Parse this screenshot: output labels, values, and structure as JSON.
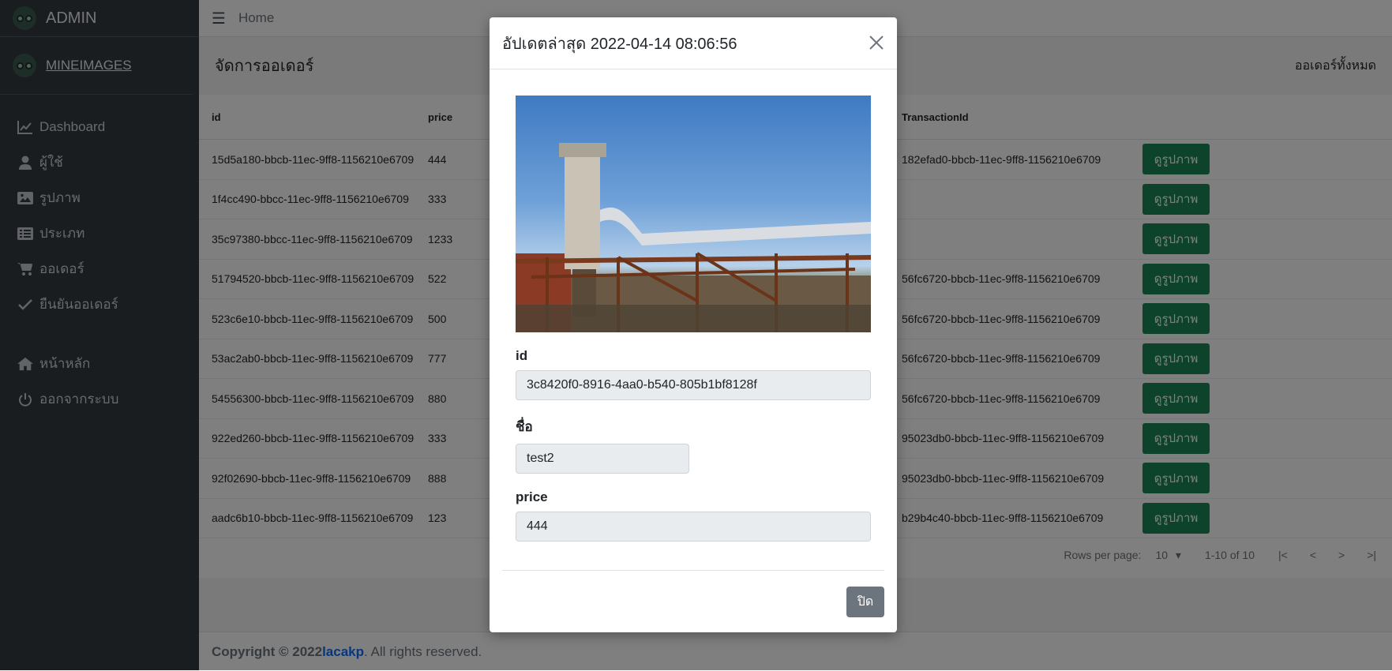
{
  "sidebar": {
    "brand": "ADMIN",
    "user": "MINEIMAGES",
    "items": [
      {
        "label": "Dashboard",
        "icon": "chart-line-icon"
      },
      {
        "label": "ผู้ใช้",
        "icon": "user-icon"
      },
      {
        "label": "รูปภาพ",
        "icon": "image-icon"
      },
      {
        "label": "ประเภท",
        "icon": "list-icon"
      },
      {
        "label": "ออเดอร์",
        "icon": "cart-icon"
      },
      {
        "label": "ยืนยันออเดอร์",
        "icon": "check-icon"
      },
      {
        "label": "หน้าหลัก",
        "icon": "home-icon"
      },
      {
        "label": "ออกจากระบบ",
        "icon": "power-icon"
      }
    ]
  },
  "topbar": {
    "home": "Home"
  },
  "page": {
    "title": "จัดการออเดอร์",
    "right_label": "ออเดอร์ทั้งหมด"
  },
  "table": {
    "columns": {
      "id": "id",
      "price": "price",
      "transaction": "TransactionId"
    },
    "view_label": "ดูรูปภาพ",
    "rows": [
      {
        "id": "15d5a180-bbcb-11ec-9ff8-1156210e6709",
        "price": "444",
        "tx": "182efad0-bbcb-11ec-9ff8-1156210e6709"
      },
      {
        "id": "1f4cc490-bbcc-11ec-9ff8-1156210e6709",
        "price": "333",
        "tx": ""
      },
      {
        "id": "35c97380-bbcc-11ec-9ff8-1156210e6709",
        "price": "1233",
        "tx": ""
      },
      {
        "id": "51794520-bbcb-11ec-9ff8-1156210e6709",
        "price": "522",
        "tx": "56fc6720-bbcb-11ec-9ff8-1156210e6709"
      },
      {
        "id": "523c6e10-bbcb-11ec-9ff8-1156210e6709",
        "price": "500",
        "tx": "56fc6720-bbcb-11ec-9ff8-1156210e6709"
      },
      {
        "id": "53ac2ab0-bbcb-11ec-9ff8-1156210e6709",
        "price": "777",
        "tx": "56fc6720-bbcb-11ec-9ff8-1156210e6709"
      },
      {
        "id": "54556300-bbcb-11ec-9ff8-1156210e6709",
        "price": "880",
        "tx": "56fc6720-bbcb-11ec-9ff8-1156210e6709"
      },
      {
        "id": "922ed260-bbcb-11ec-9ff8-1156210e6709",
        "price": "333",
        "tx": "95023db0-bbcb-11ec-9ff8-1156210e6709"
      },
      {
        "id": "92f02690-bbcb-11ec-9ff8-1156210e6709",
        "price": "888",
        "tx": "95023db0-bbcb-11ec-9ff8-1156210e6709"
      },
      {
        "id": "aadc6b10-bbcb-11ec-9ff8-1156210e6709",
        "price": "123",
        "tx": "b29b4c40-bbcb-11ec-9ff8-1156210e6709"
      }
    ]
  },
  "pager": {
    "rows_label": "Rows per page:",
    "rows_value": "10",
    "range": "1-10 of 10"
  },
  "footer": {
    "prefix": "Copyright © 2022",
    "link": "lacakp",
    "suffix": ". All rights reserved."
  },
  "modal": {
    "title": "อัปเดตล่าสุด 2022-04-14 08:06:56",
    "id_label": "id",
    "id_value": "3c8420f0-8916-4aa0-b540-805b1bf8128f",
    "name_label": "ชื่อ",
    "name_value": "test2",
    "price_label": "price",
    "price_value": "444",
    "close_label": "ปิด"
  }
}
